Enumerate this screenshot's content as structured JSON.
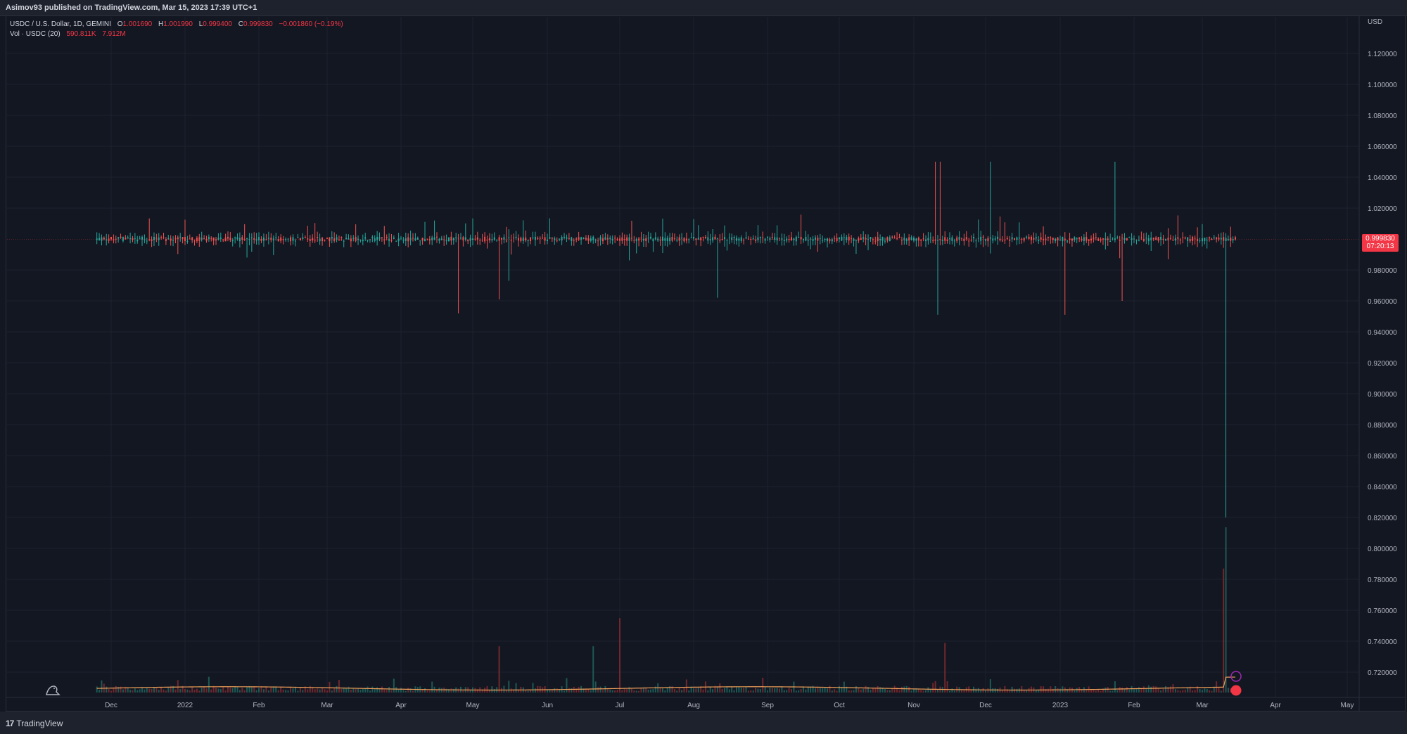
{
  "header": {
    "published": "Asimov93 published on TradingView.com, Mar 15, 2023 17:39 UTC+1"
  },
  "legend": {
    "symbol": "USDC / U.S. Dollar, 1D, GEMINI",
    "o_label": "O",
    "o_value": "1.001690",
    "h_label": "H",
    "h_value": "1.001990",
    "l_label": "L",
    "l_value": "0.999400",
    "c_label": "C",
    "c_value": "0.999830",
    "change": "−0.001860 (−0.19%)",
    "vol_label": "Vol · USDC (20)",
    "vol_value": "590.811K",
    "vol_ma": "7.912M"
  },
  "price_axis": {
    "currency": "USD",
    "ticks": [
      "1.120000",
      "1.100000",
      "1.080000",
      "1.060000",
      "1.040000",
      "1.020000",
      "0.980000",
      "0.960000",
      "0.940000",
      "0.920000",
      "0.900000",
      "0.880000",
      "0.860000",
      "0.840000",
      "0.820000",
      "0.800000",
      "0.780000",
      "0.760000",
      "0.740000",
      "0.720000"
    ]
  },
  "current_price": {
    "price": "0.999830",
    "countdown": "07:20:13"
  },
  "time_axis": {
    "ticks": [
      "Dec",
      "2022",
      "Feb",
      "Mar",
      "Apr",
      "May",
      "Jun",
      "Jul",
      "Aug",
      "Sep",
      "Oct",
      "Nov",
      "Dec",
      "2023",
      "Feb",
      "Mar",
      "Apr",
      "May"
    ]
  },
  "footer": {
    "brand": "TradingView",
    "logo_mark": "17"
  },
  "colors": {
    "background": "#131722",
    "up": "#26a69a",
    "down": "#ef5350",
    "volume_ma": "#f0a058",
    "grid": "#1e222d"
  },
  "chart_data": {
    "type": "candlestick",
    "title": "USDC / U.S. Dollar, 1D, GEMINI",
    "ylim": [
      0.7,
      1.13
    ],
    "x_range": [
      "2021-11-15",
      "2023-05-15"
    ],
    "notable_wicks": [
      {
        "date": "2022-04-25",
        "low": 0.952
      },
      {
        "date": "2022-05-12",
        "low": 0.961
      },
      {
        "date": "2022-05-16",
        "low": 0.973
      },
      {
        "date": "2022-08-11",
        "low": 0.962
      },
      {
        "date": "2022-11-10",
        "high": 1.05
      },
      {
        "date": "2022-11-11",
        "low": 0.951
      },
      {
        "date": "2022-11-12",
        "high": 1.05
      },
      {
        "date": "2022-12-03",
        "high": 1.05
      },
      {
        "date": "2023-01-03",
        "low": 0.951
      },
      {
        "date": "2023-01-24",
        "high": 1.05
      },
      {
        "date": "2023-01-27",
        "low": 0.96
      },
      {
        "date": "2023-03-11",
        "low": 0.82
      },
      {
        "date": "2023-03-13",
        "high": 1.008
      }
    ],
    "last_close": 0.99983,
    "volume": {
      "ma_period": 20,
      "last": "590.811K",
      "ma": "7.912M",
      "spikes": [
        {
          "date": "2022-05-12",
          "rel": 0.28
        },
        {
          "date": "2022-06-20",
          "rel": 0.28
        },
        {
          "date": "2022-07-01",
          "rel": 0.45
        },
        {
          "date": "2022-11-14",
          "rel": 0.3
        },
        {
          "date": "2023-03-10",
          "rel": 0.75
        },
        {
          "date": "2023-03-11",
          "rel": 1.0
        }
      ]
    }
  }
}
